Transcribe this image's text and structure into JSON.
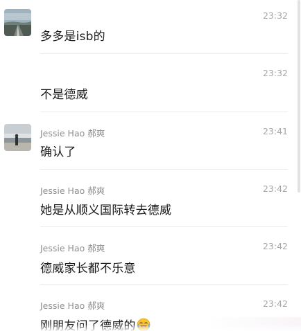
{
  "chat": {
    "messages": [
      {
        "sender": "",
        "time": "23:32",
        "text": "多多是isb的",
        "avatar": "landscape-road-avatar"
      },
      {
        "sender": "",
        "time": "23:32",
        "text": "不是德威"
      },
      {
        "sender": "Jessie Hao 郝爽",
        "time": "23:41",
        "text": "确认了",
        "avatar": "beach-person-avatar"
      },
      {
        "sender": "Jessie Hao 郝爽",
        "time": "23:42",
        "text": "她是从顺义国际转去德威"
      },
      {
        "sender": "Jessie Hao 郝爽",
        "time": "23:42",
        "text": "德威家长都不乐意"
      },
      {
        "sender": "Jessie Hao 郝爽",
        "time": "23:42",
        "text": "刚朋友问了德威的",
        "emoji": "crying-laughing-emoji"
      }
    ]
  },
  "colors": {
    "text": "#1a1a1a",
    "meta": "#8f8f8f",
    "divider": "#ececec"
  }
}
